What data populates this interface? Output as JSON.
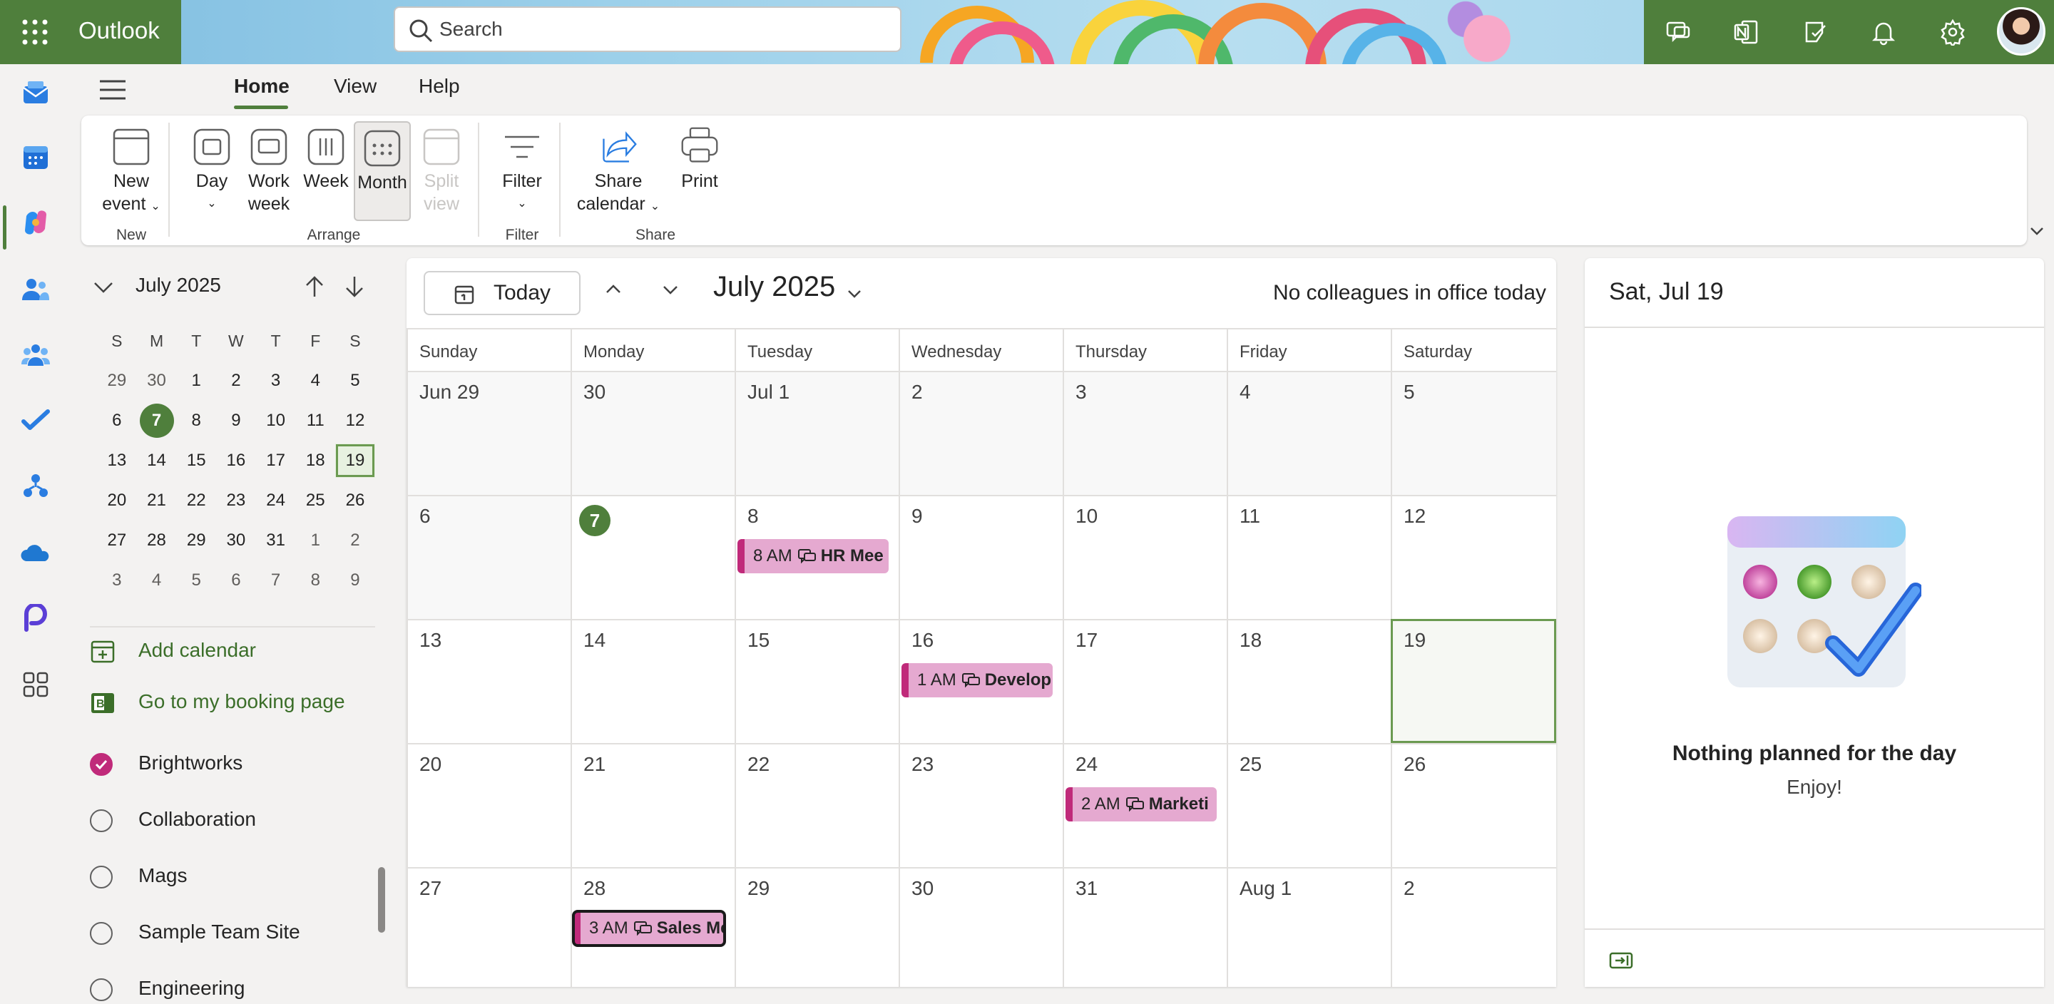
{
  "app": {
    "name": "Outlook"
  },
  "search": {
    "placeholder": "Search"
  },
  "tabs": {
    "home": "Home",
    "view": "View",
    "help": "Help"
  },
  "ribbon": {
    "new_event": {
      "line1": "New",
      "line2": "event"
    },
    "day": "Day",
    "work_week": {
      "line1": "Work",
      "line2": "week"
    },
    "week": "Week",
    "month": "Month",
    "split_view": {
      "line1": "Split",
      "line2": "view"
    },
    "filter": "Filter",
    "share_calendar": {
      "line1": "Share",
      "line2": "calendar"
    },
    "print": "Print",
    "groups": {
      "new": "New",
      "arrange": "Arrange",
      "filter": "Filter",
      "share": "Share"
    }
  },
  "mini_calendar": {
    "title": "July 2025",
    "weekdays": [
      "S",
      "M",
      "T",
      "W",
      "T",
      "F",
      "S"
    ],
    "weeks": [
      [
        "29",
        "30",
        "1",
        "2",
        "3",
        "4",
        "5"
      ],
      [
        "6",
        "7",
        "8",
        "9",
        "10",
        "11",
        "12"
      ],
      [
        "13",
        "14",
        "15",
        "16",
        "17",
        "18",
        "19"
      ],
      [
        "20",
        "21",
        "22",
        "23",
        "24",
        "25",
        "26"
      ],
      [
        "27",
        "28",
        "29",
        "30",
        "31",
        "1",
        "2"
      ],
      [
        "3",
        "4",
        "5",
        "6",
        "7",
        "8",
        "9"
      ]
    ],
    "today": "7",
    "selected": "19"
  },
  "sidebar": {
    "add_calendar": "Add calendar",
    "booking_page": "Go to my booking page",
    "calendars": [
      {
        "label": "Brightworks",
        "checked": true
      },
      {
        "label": "Collaboration",
        "checked": false
      },
      {
        "label": "Mags",
        "checked": false
      },
      {
        "label": "Sample Team Site",
        "checked": false
      },
      {
        "label": "Engineering",
        "checked": false
      }
    ]
  },
  "calendar": {
    "today_button": "Today",
    "month_title": "July 2025",
    "colleagues_status": "No colleagues in office today",
    "day_headers": [
      "Sunday",
      "Monday",
      "Tuesday",
      "Wednesday",
      "Thursday",
      "Friday",
      "Saturday"
    ],
    "weeks": [
      [
        "Jun 29",
        "30",
        "Jul 1",
        "2",
        "3",
        "4",
        "5"
      ],
      [
        "6",
        "7",
        "8",
        "9",
        "10",
        "11",
        "12"
      ],
      [
        "13",
        "14",
        "15",
        "16",
        "17",
        "18",
        "19"
      ],
      [
        "20",
        "21",
        "22",
        "23",
        "24",
        "25",
        "26"
      ],
      [
        "27",
        "28",
        "29",
        "30",
        "31",
        "Aug 1",
        "2"
      ]
    ],
    "events": [
      {
        "week": 1,
        "day": 2,
        "time": "8 AM",
        "title": "HR Mee",
        "selected": false
      },
      {
        "week": 2,
        "day": 3,
        "time": "1 AM",
        "title": "Develop",
        "selected": false
      },
      {
        "week": 3,
        "day": 4,
        "time": "2 AM",
        "title": "Marketi",
        "selected": false
      },
      {
        "week": 4,
        "day": 1,
        "time": "3 AM",
        "title": "Sales Me",
        "selected": true
      }
    ]
  },
  "right_pane": {
    "date": "Sat, Jul 19",
    "message": "Nothing planned for the day",
    "sub_message": "Enjoy!"
  },
  "colors": {
    "brand": "#4f7f3c",
    "event_fill": "#e5a9d0",
    "event_accent": "#c02a7a"
  }
}
